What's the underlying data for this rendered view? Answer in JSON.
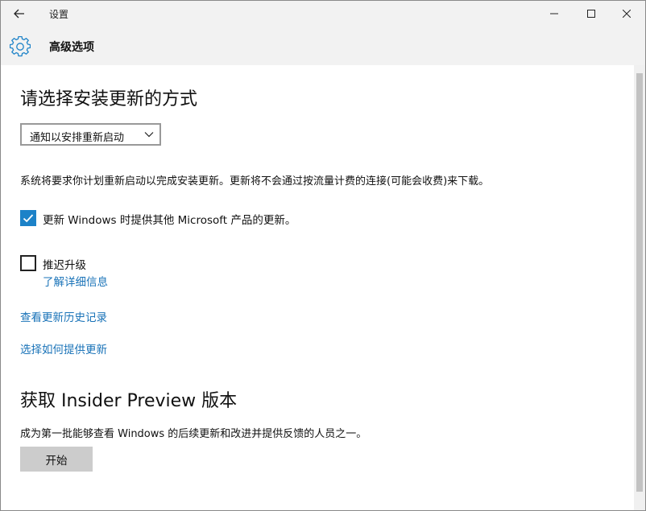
{
  "window": {
    "title": "设置"
  },
  "header": {
    "title": "高级选项"
  },
  "update_method": {
    "heading": "请选择安装更新的方式",
    "dropdown_value": "通知以安排重新启动",
    "description": "系统将要求你计划重新启动以完成安装更新。更新将不会通过按流量计费的连接(可能会收费)来下载。"
  },
  "options": {
    "ms_products_label": "更新 Windows 时提供其他 Microsoft 产品的更新。",
    "ms_products_checked": true,
    "defer_label": "推迟升级",
    "defer_checked": false,
    "learn_more": "了解详细信息"
  },
  "links": {
    "history": "查看更新历史记录",
    "delivery": "选择如何提供更新"
  },
  "insider": {
    "heading": "获取 Insider Preview 版本",
    "description": "成为第一批能够查看 Windows 的后续更新和改进并提供反馈的人员之一。",
    "start_button": "开始"
  },
  "colors": {
    "accent": "#1c82c8",
    "link": "#1a73b8",
    "chrome": "#f2f2f2"
  },
  "icons": {
    "back": "back-arrow-icon",
    "gear": "gear-icon",
    "check": "checkmark-icon",
    "chevron": "chevron-down-icon"
  }
}
